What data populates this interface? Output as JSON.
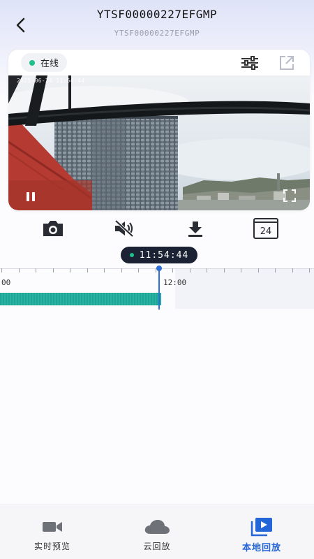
{
  "header": {
    "title": "YTSF00000227EFGMP",
    "subtitle": "YTSF00000227EFGMP"
  },
  "status": {
    "label": "在线",
    "color": "#1fc08a"
  },
  "video": {
    "timestamp": "2025-06-24 11:54:44",
    "playing": true
  },
  "card_icons": [
    "settings-sliders-icon",
    "external-link-icon"
  ],
  "controls": [
    {
      "name": "snapshot-button",
      "icon": "camera-icon"
    },
    {
      "name": "mute-button",
      "icon": "speaker-muted-icon"
    },
    {
      "name": "download-button",
      "icon": "download-icon"
    },
    {
      "name": "calendar-button",
      "icon": "calendar-icon",
      "label": "24"
    }
  ],
  "timeline": {
    "current_time": "11:54:44",
    "labels": {
      "left": "00",
      "right": "12:00"
    },
    "accent_color": "#2d6fd6",
    "record_color": "#1ea596"
  },
  "tabs": [
    {
      "label": "实时预览",
      "icon": "video-camera-icon",
      "active": false
    },
    {
      "label": "云回放",
      "icon": "cloud-icon",
      "active": false
    },
    {
      "label": "本地回放",
      "icon": "playback-icon",
      "active": true
    }
  ]
}
